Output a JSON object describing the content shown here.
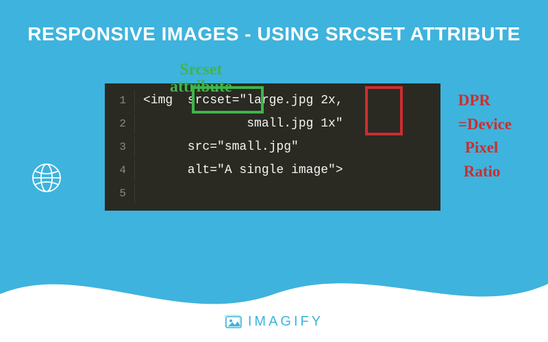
{
  "title": "RESPONSIVE IMAGES - USING SRCSET ATTRIBUTE",
  "labels": {
    "srcset": "Srcset\nattribute",
    "dpr_line1": "DPR",
    "dpr_line2": "=Device",
    "dpr_line3": "Pixel",
    "dpr_line4": "Ratio"
  },
  "code": {
    "lines": [
      {
        "num": "1",
        "text": "<img  srcset=\"large.jpg 2x,"
      },
      {
        "num": "2",
        "text": "              small.jpg 1x\""
      },
      {
        "num": "3",
        "text": "      src=\"small.jpg\""
      },
      {
        "num": "4",
        "text": "      alt=\"A single image\">"
      },
      {
        "num": "5",
        "text": ""
      }
    ]
  },
  "brand": "IMAGIFY"
}
